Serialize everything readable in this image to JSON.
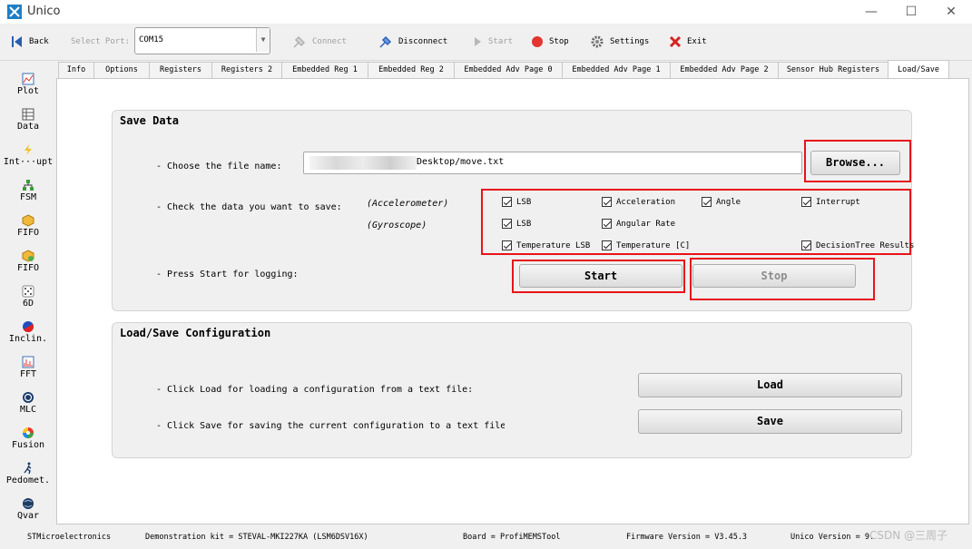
{
  "window": {
    "title": "Unico",
    "minimize": "—",
    "maximize": "☐",
    "close": "✕"
  },
  "toolbar": {
    "back": "Back",
    "select_port": "Select Port:",
    "port_value": "COM15",
    "connect": "Connect",
    "disconnect": "Disconnect",
    "start": "Start",
    "stop": "Stop",
    "settings": "Settings",
    "exit": "Exit"
  },
  "sidebar": {
    "items": [
      {
        "label": "Plot",
        "icon": "plot-icon"
      },
      {
        "label": "Data",
        "icon": "data-icon"
      },
      {
        "label": "Int···upt",
        "icon": "interrupt-icon"
      },
      {
        "label": "FSM",
        "icon": "fsm-icon"
      },
      {
        "label": "FIFO",
        "icon": "fifo-icon"
      },
      {
        "label": "FIFO",
        "icon": "fifo2-icon"
      },
      {
        "label": "6D",
        "icon": "dice-icon"
      },
      {
        "label": "Inclin.",
        "icon": "inclination-icon"
      },
      {
        "label": "FFT",
        "icon": "fft-icon"
      },
      {
        "label": "MLC",
        "icon": "mlc-icon"
      },
      {
        "label": "Fusion",
        "icon": "fusion-icon"
      },
      {
        "label": "Pedomet.",
        "icon": "pedometer-icon"
      },
      {
        "label": "Qvar",
        "icon": "qvar-icon"
      }
    ]
  },
  "tabs": [
    {
      "label": "Info"
    },
    {
      "label": "Options"
    },
    {
      "label": "Registers"
    },
    {
      "label": "Registers 2"
    },
    {
      "label": "Embedded Reg 1"
    },
    {
      "label": "Embedded Reg 2"
    },
    {
      "label": "Embedded Adv Page 0"
    },
    {
      "label": "Embedded Adv Page 1"
    },
    {
      "label": "Embedded Adv Page 2"
    },
    {
      "label": "Sensor Hub Registers"
    },
    {
      "label": "Load/Save",
      "active": true
    }
  ],
  "save_data": {
    "title": "Save Data",
    "choose_file_label": "- Choose the file name:",
    "file_path": "Desktop/move.txt",
    "browse": "Browse...",
    "check_data_label": "- Check the data you want to save:",
    "accelerometer": "(Accelerometer)",
    "gyroscope": "(Gyroscope)",
    "checkboxes": {
      "acc_lsb": "LSB",
      "acc_acceleration": "Acceleration",
      "acc_angle": "Angle",
      "acc_interrupt": "Interrupt",
      "gyro_lsb": "LSB",
      "gyro_angular_rate": "Angular Rate",
      "temp_lsb": "Temperature LSB",
      "temp_c": "Temperature [C]",
      "decision_tree": "DecisionTree Results"
    },
    "press_start_label": "- Press Start for logging:",
    "start": "Start",
    "stop": "Stop"
  },
  "load_save_config": {
    "title": "Load/Save Configuration",
    "load_label": "- Click Load for loading a configuration from a text file:",
    "save_label": "- Click Save for saving the current configuration to a text file",
    "load": "Load",
    "save": "Save"
  },
  "statusbar": {
    "company": "STMicroelectronics",
    "kit": "Demonstration kit = STEVAL-MKI227KA (LSM6DSV16X)",
    "board": "Board = ProfiMEMSTool",
    "firmware": "Firmware Version = V3.45.3",
    "unico_version": "Unico Version = 9.",
    "watermark": "CSDN @三周子"
  },
  "colors": {
    "highlight": "#e8141b",
    "window_bg": "#f0f0f0"
  }
}
